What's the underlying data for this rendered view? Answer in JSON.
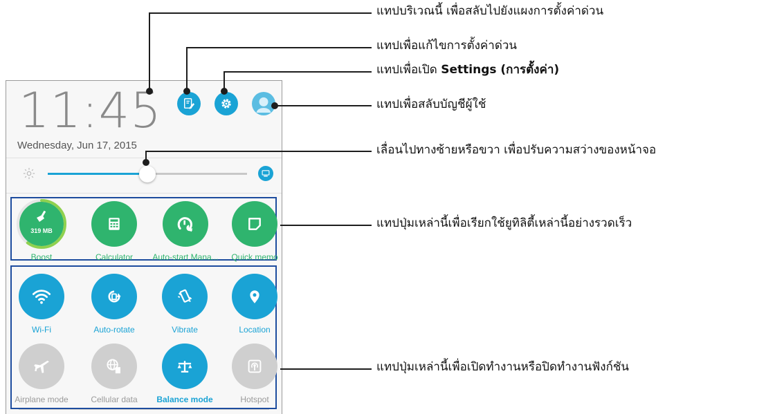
{
  "status": {
    "time": "11:45",
    "date": "Wednesday, Jun 17, 2015"
  },
  "quick_tools": [
    {
      "label": "Boost",
      "badge": "319 MB",
      "icon": "broom-icon",
      "boost_level": 0.6
    },
    {
      "label": "Calculator",
      "icon": "calculator-icon"
    },
    {
      "label": "Auto-start Mana...",
      "icon": "gauge-wrench-icon"
    },
    {
      "label": "Quick memo",
      "icon": "memo-icon"
    }
  ],
  "toggles": [
    {
      "label": "Wi-Fi",
      "icon": "wifi-icon",
      "state": "on"
    },
    {
      "label": "Auto-rotate",
      "icon": "rotate-icon",
      "state": "on"
    },
    {
      "label": "Vibrate",
      "icon": "vibrate-icon",
      "state": "on"
    },
    {
      "label": "Location",
      "icon": "location-pin-icon",
      "state": "on"
    },
    {
      "label": "Airplane mode",
      "icon": "airplane-icon",
      "state": "off"
    },
    {
      "label": "Cellular data",
      "icon": "globe-sim-icon",
      "state": "off"
    },
    {
      "label": "Balance mode",
      "icon": "balance-scale-icon",
      "state": "on"
    },
    {
      "label": "Hotspot",
      "icon": "hotspot-icon",
      "state": "off"
    }
  ],
  "brightness": {
    "level": 0.5
  },
  "callouts": {
    "switch_panel": "แทปบริเวณนี้ เพื่อสลับไปยังแผงการตั้งค่าด่วน",
    "edit_settings": "แทปเพื่อแก้ไขการตั้งค่าด่วน",
    "open_settings_prefix": "แทปเพื่อเปิด ",
    "open_settings_bold": "Settings (การตั้งค่า)",
    "switch_user": "แทปเพื่อสลับบัญชีผู้ใช้",
    "brightness": "เลื่อนไปทางซ้ายหรือขวา เพื่อปรับความสว่างของหน้าจอ",
    "quick_tools": "แทปปุ่มเหล่านี้เพื่อเรียกใช้ยูทิลิตี้เหล่านี้อย่างรวดเร็ว",
    "toggles": "แทปปุ่มเหล่านี้เพื่อเปิดทำงานหรือปิดทำงานฟังก์ชัน"
  },
  "colors": {
    "accent": "#1aa3d5",
    "tool_green": "#2fb46e",
    "off_gray": "#cfcfcf",
    "panel_border": "#1d4c9e"
  }
}
